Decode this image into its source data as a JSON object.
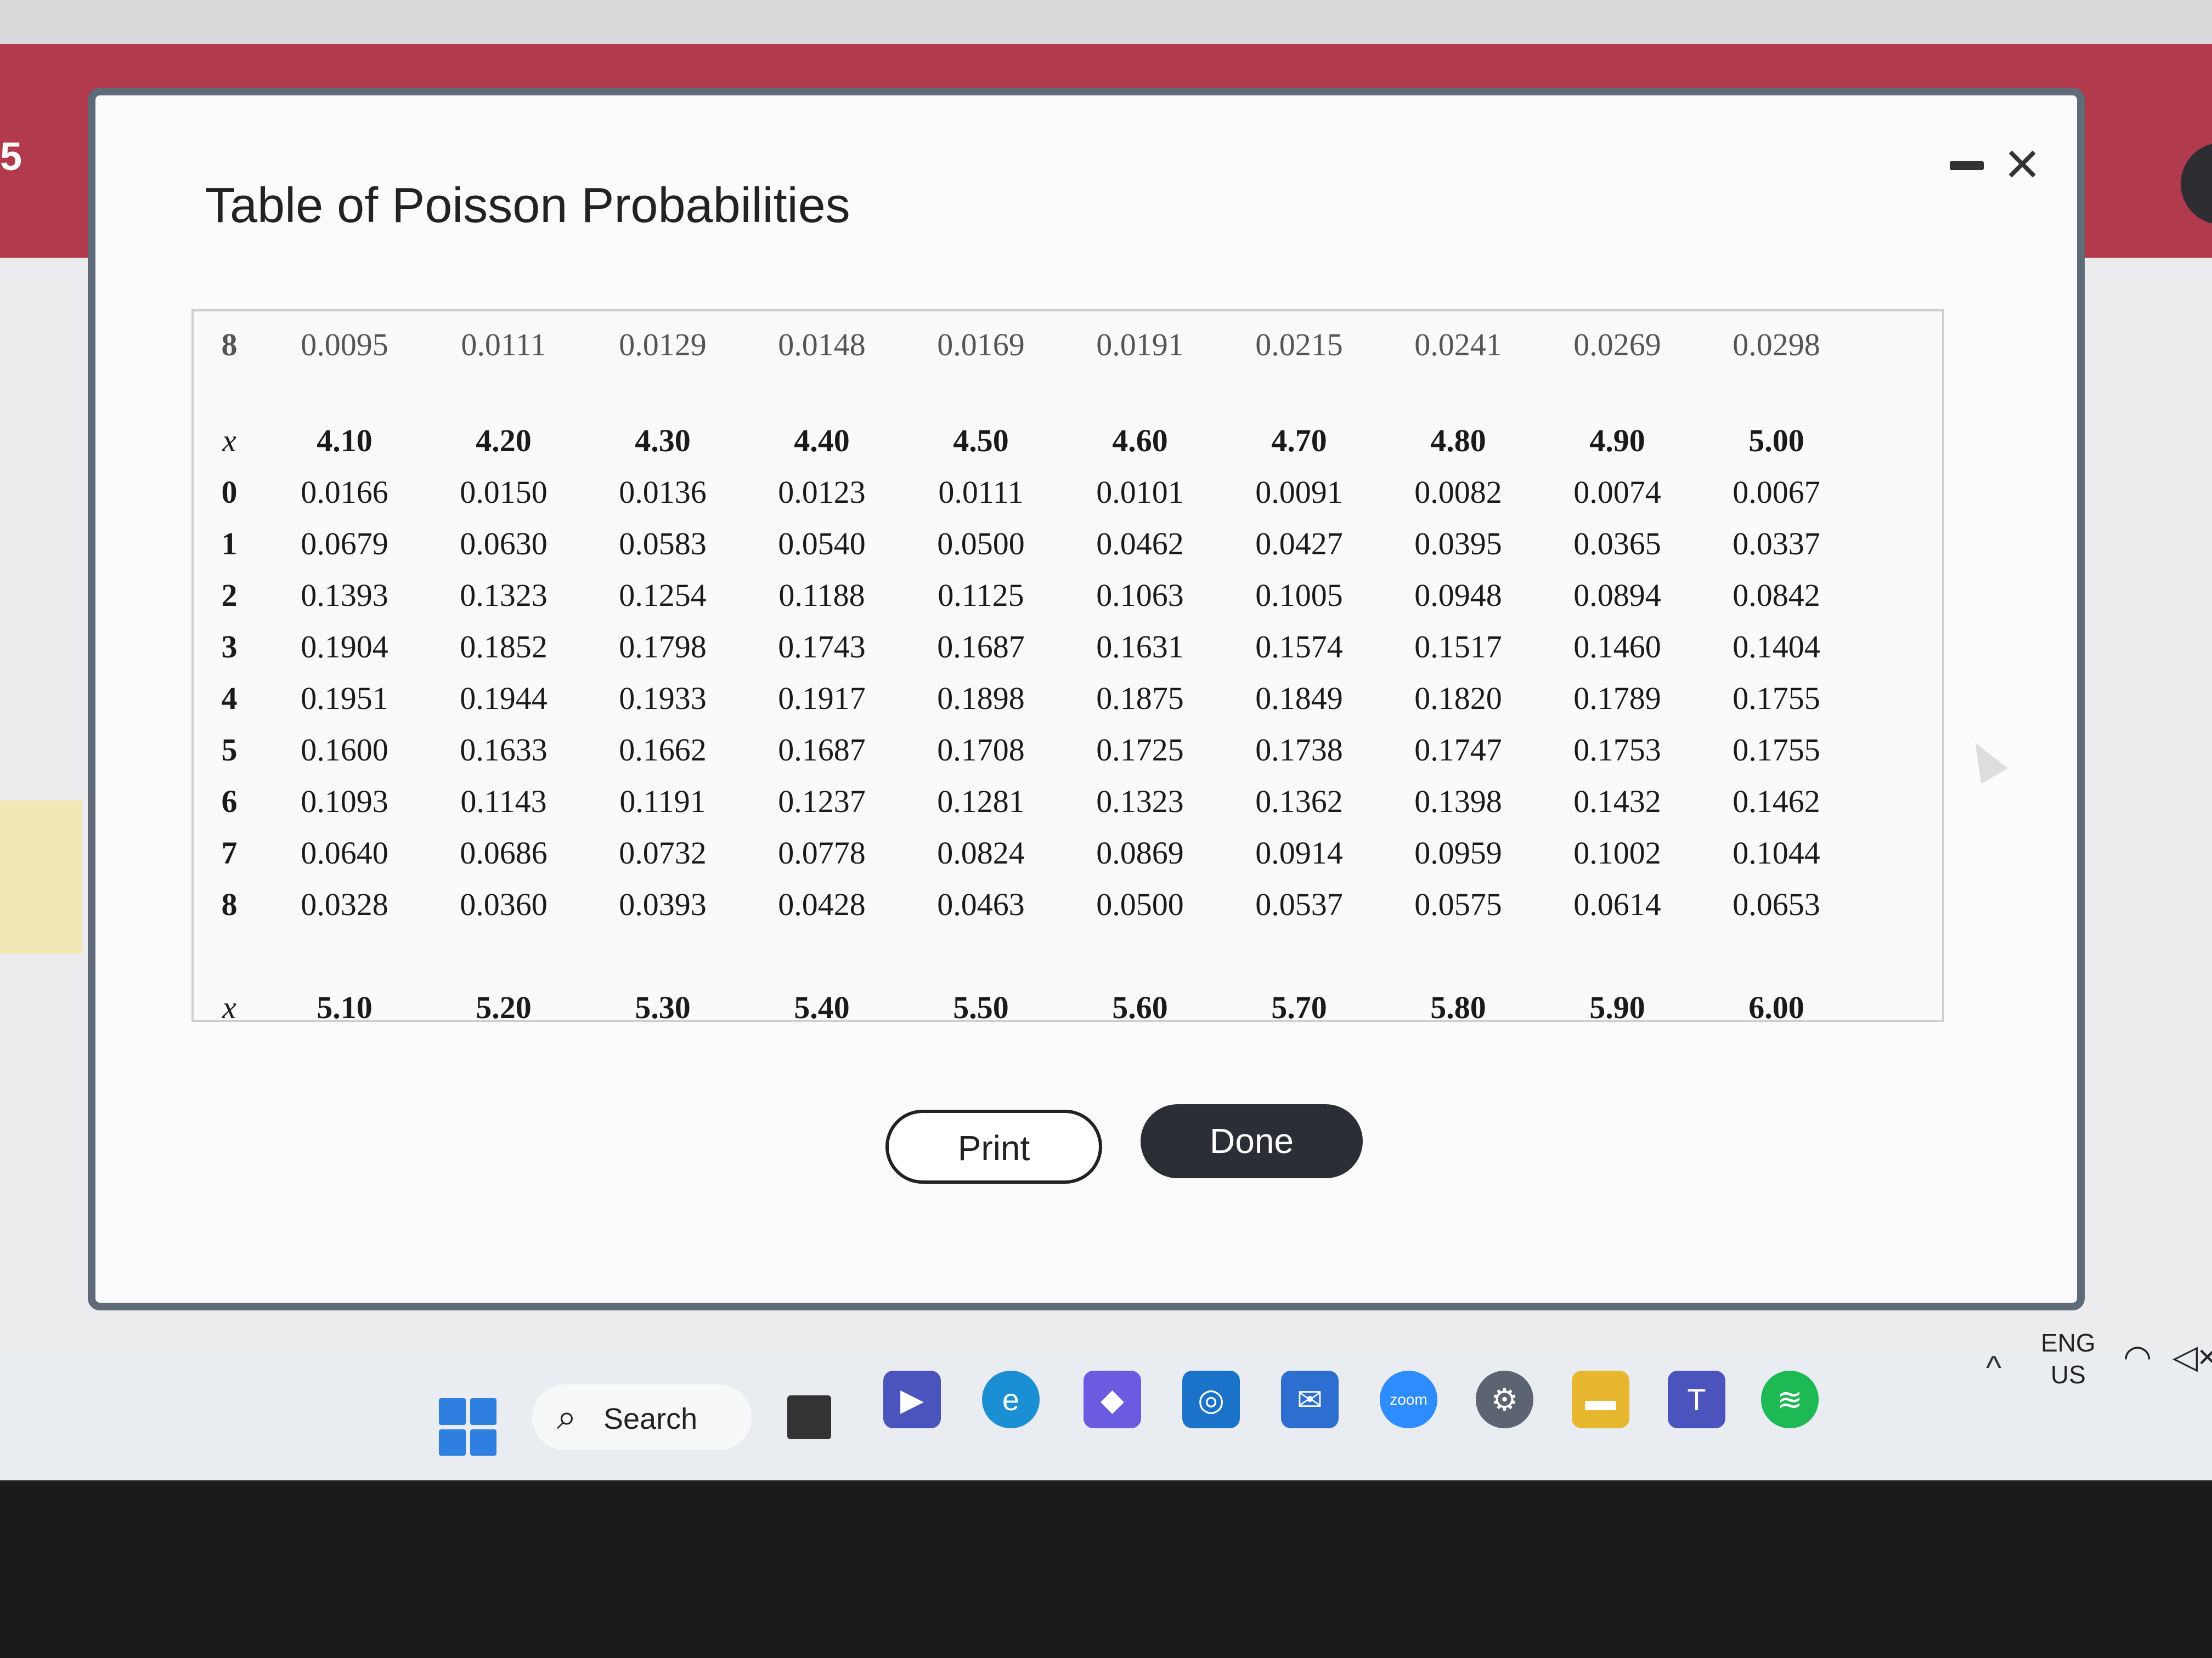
{
  "background": {
    "page_fragment": "5"
  },
  "dialog": {
    "title": "Table of Poisson Probabilities",
    "minimize_label": "",
    "close_glyph": "×"
  },
  "table": {
    "partial_top_row": {
      "x": "8",
      "values": [
        "0.0095",
        "0.0111",
        "0.0129",
        "0.0148",
        "0.0169",
        "0.0191",
        "0.0215",
        "0.0241",
        "0.0269",
        "0.0298"
      ]
    },
    "header_x": "x",
    "lambdas": [
      "4.10",
      "4.20",
      "4.30",
      "4.40",
      "4.50",
      "4.60",
      "4.70",
      "4.80",
      "4.90",
      "5.00"
    ],
    "rows": [
      {
        "x": "0",
        "values": [
          "0.0166",
          "0.0150",
          "0.0136",
          "0.0123",
          "0.0111",
          "0.0101",
          "0.0091",
          "0.0082",
          "0.0074",
          "0.0067"
        ]
      },
      {
        "x": "1",
        "values": [
          "0.0679",
          "0.0630",
          "0.0583",
          "0.0540",
          "0.0500",
          "0.0462",
          "0.0427",
          "0.0395",
          "0.0365",
          "0.0337"
        ]
      },
      {
        "x": "2",
        "values": [
          "0.1393",
          "0.1323",
          "0.1254",
          "0.1188",
          "0.1125",
          "0.1063",
          "0.1005",
          "0.0948",
          "0.0894",
          "0.0842"
        ]
      },
      {
        "x": "3",
        "values": [
          "0.1904",
          "0.1852",
          "0.1798",
          "0.1743",
          "0.1687",
          "0.1631",
          "0.1574",
          "0.1517",
          "0.1460",
          "0.1404"
        ]
      },
      {
        "x": "4",
        "values": [
          "0.1951",
          "0.1944",
          "0.1933",
          "0.1917",
          "0.1898",
          "0.1875",
          "0.1849",
          "0.1820",
          "0.1789",
          "0.1755"
        ]
      },
      {
        "x": "5",
        "values": [
          "0.1600",
          "0.1633",
          "0.1662",
          "0.1687",
          "0.1708",
          "0.1725",
          "0.1738",
          "0.1747",
          "0.1753",
          "0.1755"
        ]
      },
      {
        "x": "6",
        "values": [
          "0.1093",
          "0.1143",
          "0.1191",
          "0.1237",
          "0.1281",
          "0.1323",
          "0.1362",
          "0.1398",
          "0.1432",
          "0.1462"
        ]
      },
      {
        "x": "7",
        "values": [
          "0.0640",
          "0.0686",
          "0.0732",
          "0.0778",
          "0.0824",
          "0.0869",
          "0.0914",
          "0.0959",
          "0.1002",
          "0.1044"
        ]
      },
      {
        "x": "8",
        "values": [
          "0.0328",
          "0.0360",
          "0.0393",
          "0.0428",
          "0.0463",
          "0.0500",
          "0.0537",
          "0.0575",
          "0.0614",
          "0.0653"
        ]
      }
    ],
    "next_header_x": "x",
    "next_lambdas": [
      "5.10",
      "5.20",
      "5.30",
      "5.40",
      "5.50",
      "5.60",
      "5.70",
      "5.80",
      "5.90",
      "6.00"
    ]
  },
  "buttons": {
    "print": "Print",
    "done": "Done"
  },
  "taskbar": {
    "search_label": "Search",
    "icons": [
      "windows-start-icon",
      "search-icon",
      "task-view-icon",
      "teams-meet-icon",
      "edge-icon",
      "copilot-icon",
      "outlook-calendar-icon",
      "mail-icon",
      "zoom-icon",
      "settings-icon",
      "file-explorer-icon",
      "teams-icon",
      "spotify-icon"
    ],
    "zoom_label": "zoom",
    "tray": {
      "lang_line1": "ENG",
      "lang_line2": "US",
      "chevron": "^"
    }
  },
  "colors": {
    "banner": "#b13b4c",
    "done_button": "#2b2f35",
    "dialog_border": "#5f6b78"
  }
}
